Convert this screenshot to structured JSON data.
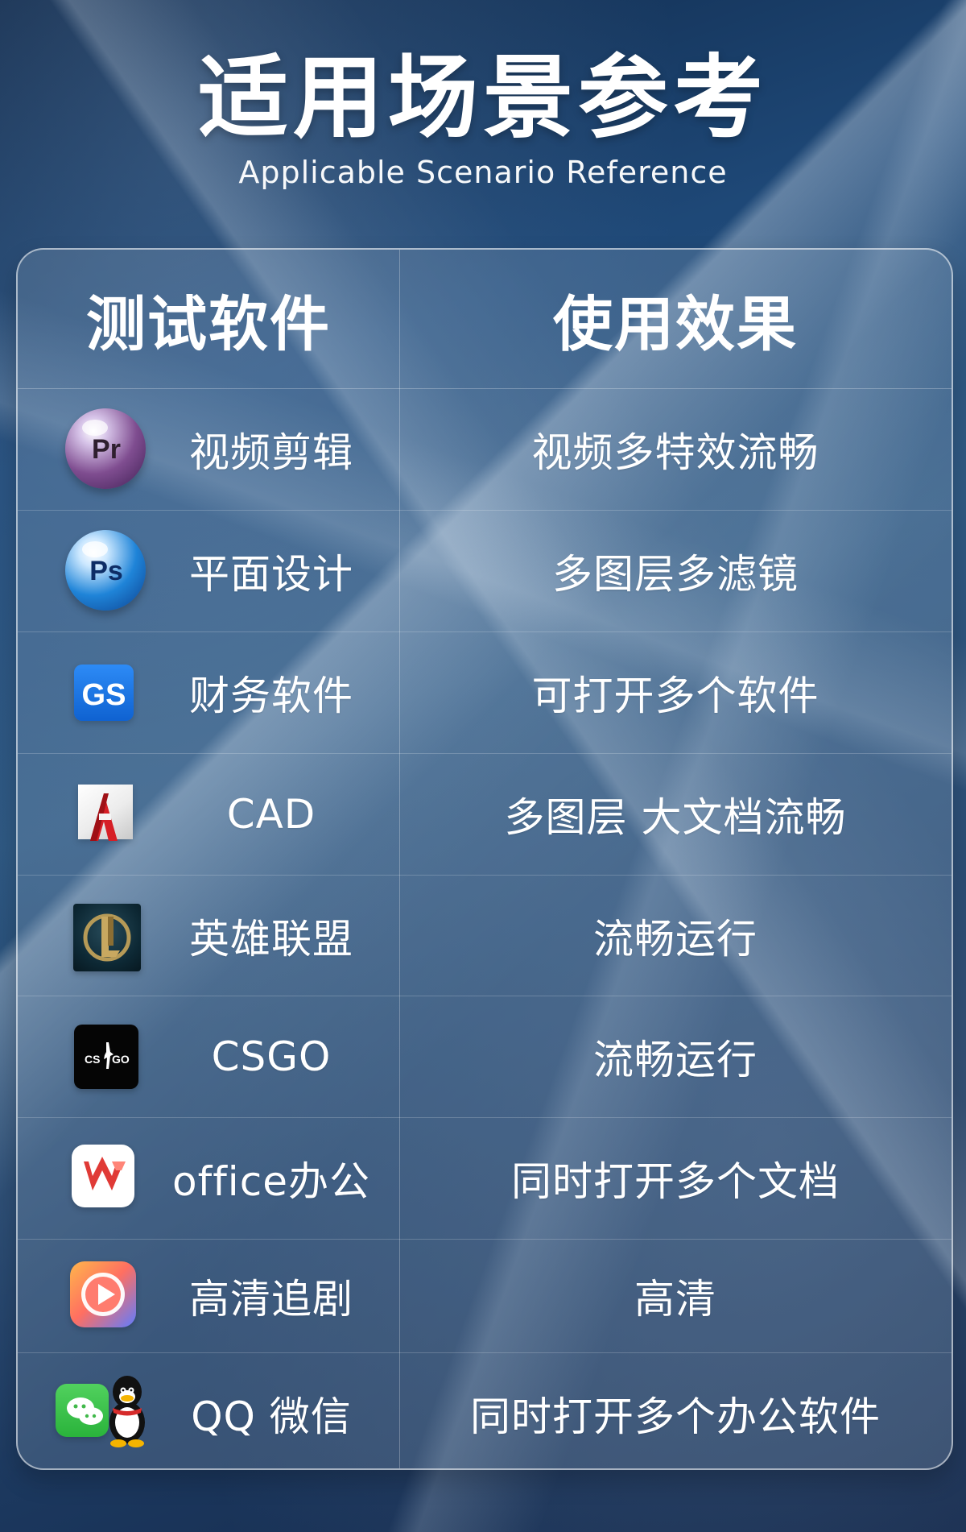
{
  "header": {
    "title_cn": "适用场景参考",
    "title_en": "Applicable Scenario Reference"
  },
  "table": {
    "headers": [
      "测试软件",
      "使用效果"
    ],
    "rows": [
      {
        "icon": "premiere-pro-icon",
        "software": "视频剪辑",
        "effect": "视频多特效流畅"
      },
      {
        "icon": "photoshop-icon",
        "software": "平面设计",
        "effect": "多图层多滤镜"
      },
      {
        "icon": "gs-finance-icon",
        "software": "财务软件",
        "effect": "可打开多个软件"
      },
      {
        "icon": "autocad-icon",
        "software": "CAD",
        "effect": "多图层 大文档流畅"
      },
      {
        "icon": "league-of-legends-icon",
        "software": "英雄联盟",
        "effect": "流畅运行"
      },
      {
        "icon": "csgo-icon",
        "software": "CSGO",
        "effect": "流畅运行"
      },
      {
        "icon": "wps-office-icon",
        "software": "office办公",
        "effect": "同时打开多个文档"
      },
      {
        "icon": "video-player-icon",
        "software": "高清追剧",
        "effect": "高清"
      },
      {
        "icon": "wechat-qq-icons",
        "software": "QQ 微信",
        "effect": "同时打开多个办公软件"
      }
    ]
  }
}
